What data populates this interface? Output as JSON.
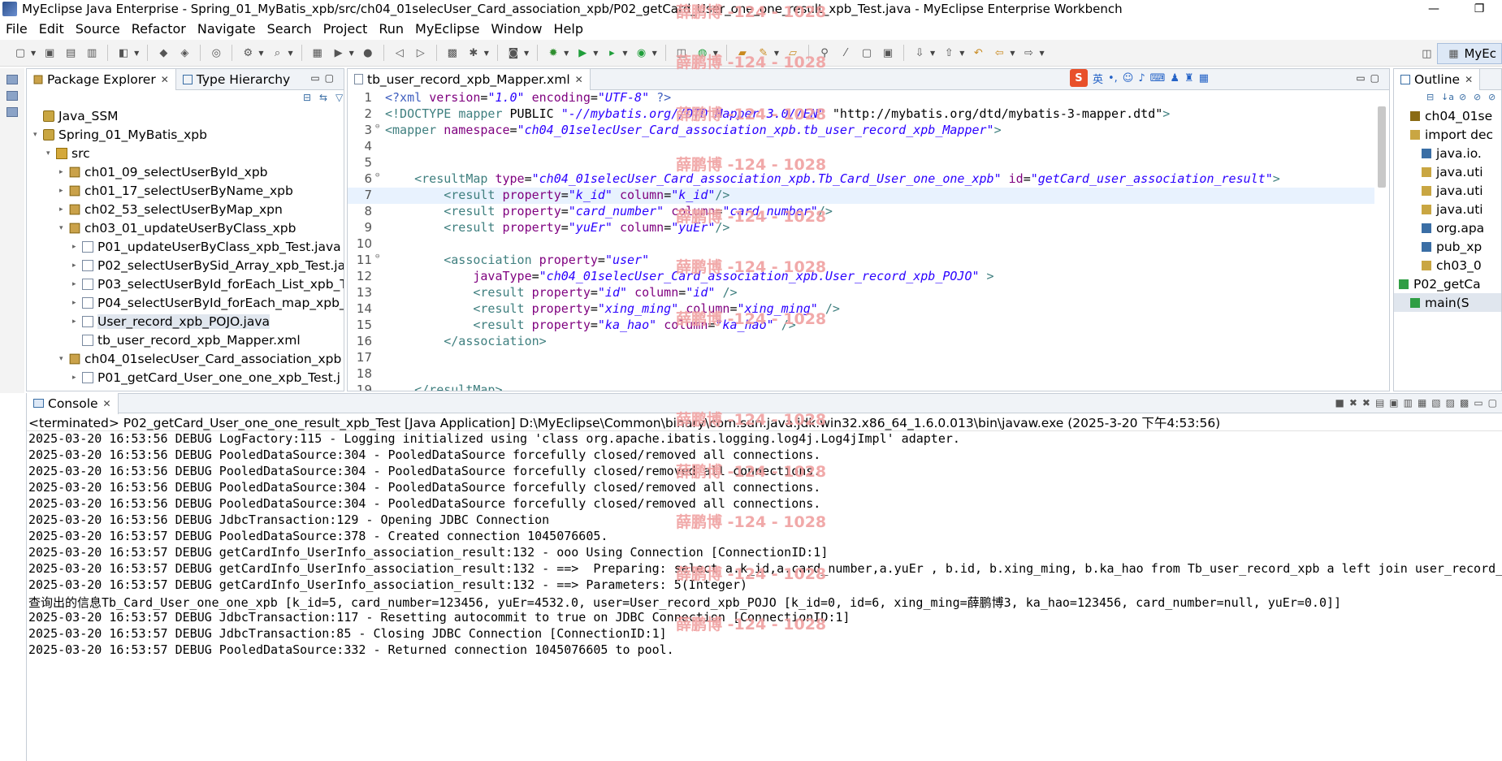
{
  "window": {
    "title": "MyEclipse Java Enterprise - Spring_01_MyBatis_xpb/src/ch04_01selecUser_Card_association_xpb/P02_getCard_User_one_one_result_xpb_Test.java - MyEclipse Enterprise Workbench",
    "minimize_glyph": "—",
    "restore_glyph": "❐"
  },
  "menubar": [
    "File",
    "Edit",
    "Source",
    "Refactor",
    "Navigate",
    "Search",
    "Project",
    "Run",
    "MyEclipse",
    "Window",
    "Help"
  ],
  "perspective": {
    "label": "MyEc"
  },
  "package_explorer": {
    "tab_label": "Package Explorer",
    "tab2_label": "Type Hierarchy",
    "tree": [
      {
        "label": "Java_SSM",
        "indent": 0,
        "icon": "project-icon",
        "twisty": ""
      },
      {
        "label": "Spring_01_MyBatis_xpb",
        "indent": 0,
        "icon": "project-icon",
        "twisty": "▾"
      },
      {
        "label": "src",
        "indent": 1,
        "icon": "source-folder-icon",
        "twisty": "▾"
      },
      {
        "label": "ch01_09_selectUserById_xpb",
        "indent": 2,
        "icon": "package-icon",
        "twisty": "▸"
      },
      {
        "label": "ch01_17_selectUserByName_xpb",
        "indent": 2,
        "icon": "package-icon",
        "twisty": "▸"
      },
      {
        "label": "ch02_53_selectUserByMap_xpn",
        "indent": 2,
        "icon": "package-icon",
        "twisty": "▸"
      },
      {
        "label": "ch03_01_updateUserByClass_xpb",
        "indent": 2,
        "icon": "package-icon",
        "twisty": "▾"
      },
      {
        "label": "P01_updateUserByClass_xpb_Test.java",
        "indent": 3,
        "icon": "java-file-icon",
        "twisty": "▸"
      },
      {
        "label": "P02_selectUserBySid_Array_xpb_Test.ja",
        "indent": 3,
        "icon": "java-file-icon",
        "twisty": "▸"
      },
      {
        "label": "P03_selectUserById_forEach_List_xpb_T",
        "indent": 3,
        "icon": "java-file-icon",
        "twisty": "▸"
      },
      {
        "label": "P04_selectUserById_forEach_map_xpb_",
        "indent": 3,
        "icon": "java-file-icon",
        "twisty": "▸"
      },
      {
        "label": "User_record_xpb_POJO.java",
        "indent": 3,
        "icon": "java-file-icon",
        "twisty": "▸",
        "selected": true
      },
      {
        "label": "tb_user_record_xpb_Mapper.xml",
        "indent": 3,
        "icon": "xml-file-icon",
        "twisty": ""
      },
      {
        "label": "ch04_01selecUser_Card_association_xpb",
        "indent": 2,
        "icon": "package-icon",
        "twisty": "▾"
      },
      {
        "label": "P01_getCard_User_one_one_xpb_Test.j",
        "indent": 3,
        "icon": "java-file-icon",
        "twisty": "▸"
      }
    ]
  },
  "editor": {
    "tab_label": "tb_user_record_xpb_Mapper.xml",
    "ime": {
      "logo": "S",
      "lang": "英"
    },
    "lines": [
      {
        "n": "1",
        "fold": "",
        "segs": [
          [
            "pi",
            "<?xml "
          ],
          [
            "attr",
            "version"
          ],
          [
            "plain",
            "="
          ],
          [
            "val",
            "\"1.0\""
          ],
          [
            "plain",
            " "
          ],
          [
            "attr",
            "encoding"
          ],
          [
            "plain",
            "="
          ],
          [
            "val",
            "\"UTF-8\""
          ],
          [
            "plain",
            " "
          ],
          [
            "pi",
            "?>"
          ]
        ]
      },
      {
        "n": "2",
        "fold": "",
        "segs": [
          [
            "tag",
            "<!DOCTYPE "
          ],
          [
            "tag",
            "mapper "
          ],
          [
            "plain",
            "PUBLIC "
          ],
          [
            "val",
            "\"-//mybatis.org//DTD Mapper 3.0//EN\""
          ],
          [
            "plain",
            " "
          ],
          [
            "plain",
            "\"http://mybatis.org/dtd/mybatis-3-mapper.dtd\""
          ],
          [
            "tag",
            ">"
          ]
        ]
      },
      {
        "n": "3",
        "fold": "⊖",
        "segs": [
          [
            "tag",
            "<mapper "
          ],
          [
            "attr",
            "namespace"
          ],
          [
            "plain",
            "="
          ],
          [
            "val",
            "\"ch04_01selecUser_Card_association_xpb.tb_user_record_xpb_Mapper\""
          ],
          [
            "tag",
            ">"
          ]
        ]
      },
      {
        "n": "4",
        "fold": "",
        "segs": []
      },
      {
        "n": "5",
        "fold": "",
        "segs": []
      },
      {
        "n": "6",
        "fold": "⊖",
        "segs": [
          [
            "plain",
            "    "
          ],
          [
            "tag",
            "<resultMap "
          ],
          [
            "attr",
            "type"
          ],
          [
            "plain",
            "="
          ],
          [
            "val",
            "\"ch04_01selecUser_Card_association_xpb.Tb_Card_User_one_one_xpb\""
          ],
          [
            "plain",
            " "
          ],
          [
            "attr",
            "id"
          ],
          [
            "plain",
            "="
          ],
          [
            "val",
            "\"getCard_user_association_result\""
          ],
          [
            "tag",
            ">"
          ]
        ]
      },
      {
        "n": "7",
        "fold": "",
        "cur": true,
        "segs": [
          [
            "plain",
            "        "
          ],
          [
            "tag",
            "<result "
          ],
          [
            "attr",
            "property"
          ],
          [
            "plain",
            "="
          ],
          [
            "val",
            "\"k_id\""
          ],
          [
            "plain",
            " "
          ],
          [
            "attr",
            "column"
          ],
          [
            "plain",
            "="
          ],
          [
            "val",
            "\"k_id\""
          ],
          [
            "tag",
            "/>"
          ]
        ]
      },
      {
        "n": "8",
        "fold": "",
        "segs": [
          [
            "plain",
            "        "
          ],
          [
            "tag",
            "<result "
          ],
          [
            "attr",
            "property"
          ],
          [
            "plain",
            "="
          ],
          [
            "val",
            "\"card_number\""
          ],
          [
            "plain",
            " "
          ],
          [
            "attr",
            "column"
          ],
          [
            "plain",
            "="
          ],
          [
            "val",
            "\"card_number\""
          ],
          [
            "tag",
            "/>"
          ]
        ]
      },
      {
        "n": "9",
        "fold": "",
        "segs": [
          [
            "plain",
            "        "
          ],
          [
            "tag",
            "<result "
          ],
          [
            "attr",
            "property"
          ],
          [
            "plain",
            "="
          ],
          [
            "val",
            "\"yuEr\""
          ],
          [
            "plain",
            " "
          ],
          [
            "attr",
            "column"
          ],
          [
            "plain",
            "="
          ],
          [
            "val",
            "\"yuEr\""
          ],
          [
            "tag",
            "/>"
          ]
        ]
      },
      {
        "n": "10",
        "fold": "",
        "segs": []
      },
      {
        "n": "11",
        "fold": "⊖",
        "segs": [
          [
            "plain",
            "        "
          ],
          [
            "tag",
            "<association "
          ],
          [
            "attr",
            "property"
          ],
          [
            "plain",
            "="
          ],
          [
            "val",
            "\"user\""
          ]
        ]
      },
      {
        "n": "12",
        "fold": "",
        "segs": [
          [
            "plain",
            "            "
          ],
          [
            "attr",
            "javaType"
          ],
          [
            "plain",
            "="
          ],
          [
            "val",
            "\"ch04_01selecUser_Card_association_xpb.User_record_xpb_POJO\""
          ],
          [
            "plain",
            " "
          ],
          [
            "tag",
            ">"
          ]
        ]
      },
      {
        "n": "13",
        "fold": "",
        "segs": [
          [
            "plain",
            "            "
          ],
          [
            "tag",
            "<result "
          ],
          [
            "attr",
            "property"
          ],
          [
            "plain",
            "="
          ],
          [
            "val",
            "\"id\""
          ],
          [
            "plain",
            " "
          ],
          [
            "attr",
            "column"
          ],
          [
            "plain",
            "="
          ],
          [
            "val",
            "\"id\""
          ],
          [
            "plain",
            " "
          ],
          [
            "tag",
            "/>"
          ]
        ]
      },
      {
        "n": "14",
        "fold": "",
        "segs": [
          [
            "plain",
            "            "
          ],
          [
            "tag",
            "<result "
          ],
          [
            "attr",
            "property"
          ],
          [
            "plain",
            "="
          ],
          [
            "val",
            "\"xing_ming\""
          ],
          [
            "plain",
            " "
          ],
          [
            "attr",
            "column"
          ],
          [
            "plain",
            "="
          ],
          [
            "val",
            "\"xing_ming\""
          ],
          [
            "plain",
            " "
          ],
          [
            "tag",
            "/>"
          ]
        ]
      },
      {
        "n": "15",
        "fold": "",
        "segs": [
          [
            "plain",
            "            "
          ],
          [
            "tag",
            "<result "
          ],
          [
            "attr",
            "property"
          ],
          [
            "plain",
            "="
          ],
          [
            "val",
            "\"ka_hao\""
          ],
          [
            "plain",
            " "
          ],
          [
            "attr",
            "column"
          ],
          [
            "plain",
            "="
          ],
          [
            "val",
            "\"ka_hao\""
          ],
          [
            "plain",
            " "
          ],
          [
            "tag",
            "/>"
          ]
        ]
      },
      {
        "n": "16",
        "fold": "",
        "segs": [
          [
            "plain",
            "        "
          ],
          [
            "tag",
            "</association>"
          ]
        ]
      },
      {
        "n": "17",
        "fold": "",
        "segs": []
      },
      {
        "n": "18",
        "fold": "",
        "segs": []
      },
      {
        "n": "19",
        "fold": "",
        "segs": [
          [
            "plain",
            "    "
          ],
          [
            "tag",
            "</resultMap>"
          ]
        ]
      }
    ]
  },
  "outline": {
    "tab_label": "Outline",
    "rows": [
      {
        "label": "ch04_01se",
        "icon_color": "#8a6b14",
        "indent": 1
      },
      {
        "label": "import dec",
        "icon_color": "#c9a642",
        "indent": 1
      },
      {
        "label": "java.io.",
        "icon_color": "#3a6ea5",
        "indent": 2
      },
      {
        "label": "java.uti",
        "icon_color": "#c9a642",
        "indent": 2
      },
      {
        "label": "java.uti",
        "icon_color": "#c9a642",
        "indent": 2
      },
      {
        "label": "java.uti",
        "icon_color": "#c9a642",
        "indent": 2
      },
      {
        "label": "org.apa",
        "icon_color": "#3a6ea5",
        "indent": 2
      },
      {
        "label": "pub_xp",
        "icon_color": "#3a6ea5",
        "indent": 2
      },
      {
        "label": "ch03_0",
        "icon_color": "#c9a642",
        "indent": 2
      },
      {
        "label": "P02_getCa",
        "icon_color": "#2f9e44",
        "indent": 0
      },
      {
        "label": "main(S",
        "icon_color": "#2f9e44",
        "indent": 1,
        "selected": true
      }
    ]
  },
  "console": {
    "tab_label": "Console",
    "header": "<terminated> P02_getCard_User_one_one_result_xpb_Test [Java Application] D:\\MyEclipse\\Common\\binary\\com.sun.java.jdk.win32.x86_64_1.6.0.013\\bin\\javaw.exe (2025-3-20 下午4:53:56)",
    "lines": [
      "2025-03-20 16:53:56 DEBUG LogFactory:115 - Logging initialized using 'class org.apache.ibatis.logging.log4j.Log4jImpl' adapter.",
      "2025-03-20 16:53:56 DEBUG PooledDataSource:304 - PooledDataSource forcefully closed/removed all connections.",
      "2025-03-20 16:53:56 DEBUG PooledDataSource:304 - PooledDataSource forcefully closed/removed all connections.",
      "2025-03-20 16:53:56 DEBUG PooledDataSource:304 - PooledDataSource forcefully closed/removed all connections.",
      "2025-03-20 16:53:56 DEBUG PooledDataSource:304 - PooledDataSource forcefully closed/removed all connections.",
      "2025-03-20 16:53:56 DEBUG JdbcTransaction:129 - Opening JDBC Connection",
      "2025-03-20 16:53:57 DEBUG PooledDataSource:378 - Created connection 1045076605.",
      "2025-03-20 16:53:57 DEBUG getCardInfo_UserInfo_association_result:132 - ooo Using Connection [ConnectionID:1]",
      "2025-03-20 16:53:57 DEBUG getCardInfo_UserInfo_association_result:132 - ==>  Preparing: select a.k_id,a.card_number,a.yuEr , b.id, b.xing_ming, b.ka_hao from Tb_user_record_xpb a left join user_record_x",
      "2025-03-20 16:53:57 DEBUG getCardInfo_UserInfo_association_result:132 - ==> Parameters: 5(Integer)",
      "查询出的信息Tb_Card_User_one_one_xpb [k_id=5, card_number=123456, yuEr=4532.0, user=User_record_xpb_POJO [k_id=0, id=6, xing_ming=薛鹏博3, ka_hao=123456, card_number=null, yuEr=0.0]]",
      "2025-03-20 16:53:57 DEBUG JdbcTransaction:117 - Resetting autocommit to true on JDBC Connection [ConnectionID:1]",
      "2025-03-20 16:53:57 DEBUG JdbcTransaction:85 - Closing JDBC Connection [ConnectionID:1]",
      "2025-03-20 16:53:57 DEBUG PooledDataSource:332 - Returned connection 1045076605 to pool."
    ]
  },
  "watermark": "薛鹏博 -124 - 1028"
}
